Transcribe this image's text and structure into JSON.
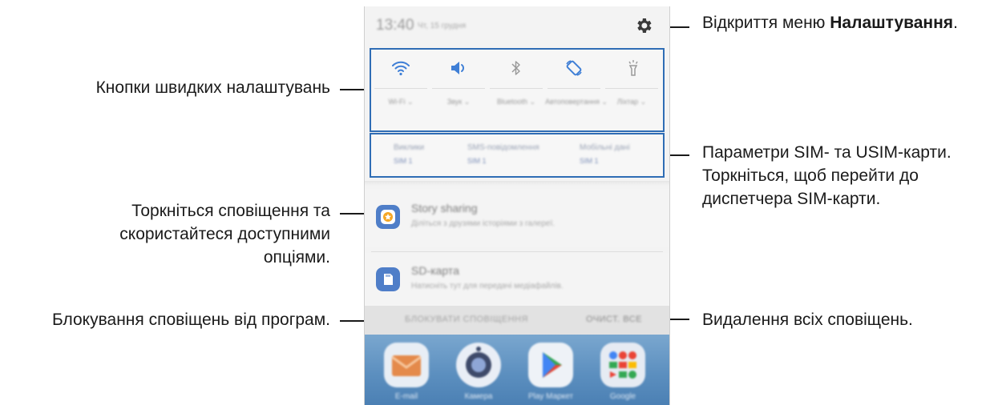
{
  "callouts": {
    "settings_prefix": "Відкриття меню ",
    "settings_bold": "Налаштування",
    "settings_suffix": ".",
    "quick_settings": "Кнопки швидких налаштувань",
    "sim": [
      "Параметри SIM- та USIM-карти.",
      "Торкніться, щоб перейти до",
      "диспетчера SIM-карти."
    ],
    "notification": [
      "Торкніться сповіщення та",
      "скористайтеся доступними",
      "опціями."
    ],
    "block": "Блокування сповіщень від програм.",
    "clear": "Видалення всіх сповіщень."
  },
  "phone": {
    "time": "13:40",
    "date": "Чт, 15 грудня",
    "quick_toggles": [
      {
        "icon": "wifi-icon",
        "label": "Wi-Fi ⌄",
        "active": true
      },
      {
        "icon": "sound-icon",
        "label": "Звук ⌄",
        "active": true
      },
      {
        "icon": "bluetooth-icon",
        "label": "Bluetooth ⌄",
        "active": false
      },
      {
        "icon": "auto-rotate-icon",
        "label": "Автоповертання ⌄",
        "active": true
      },
      {
        "icon": "flashlight-icon",
        "label": "Ліхтар ⌄",
        "active": false
      }
    ],
    "sim_cards": [
      {
        "title": "Виклики",
        "sim": "SIM 1"
      },
      {
        "title": "SMS-повідомлення",
        "sim": "SIM 1"
      },
      {
        "title": "Мобільні дані",
        "sim": "SIM 1"
      }
    ],
    "notifications": [
      {
        "icon": "story-sharing-icon",
        "title": "Story sharing",
        "text": "Діліться з друзями історіями з галереї."
      },
      {
        "icon": "sd-card-icon",
        "title": "SD-карта",
        "text": "Натисніть тут для передачі медіафайлів."
      }
    ],
    "block_label": "БЛОКУВАТИ СПОВІЩЕННЯ",
    "clear_label": "ОЧИСТ. ВСЕ",
    "apps": [
      {
        "icon": "email-icon",
        "label": "E-mail"
      },
      {
        "icon": "camera-icon",
        "label": "Камера"
      },
      {
        "icon": "play-store-icon",
        "label": "Play Маркет"
      },
      {
        "icon": "google-folder-icon",
        "label": "Google"
      }
    ]
  },
  "colors": {
    "highlight_border": "#2f6db5",
    "accent_blue": "#3f7fd6",
    "leader": "#1a1a1a"
  }
}
